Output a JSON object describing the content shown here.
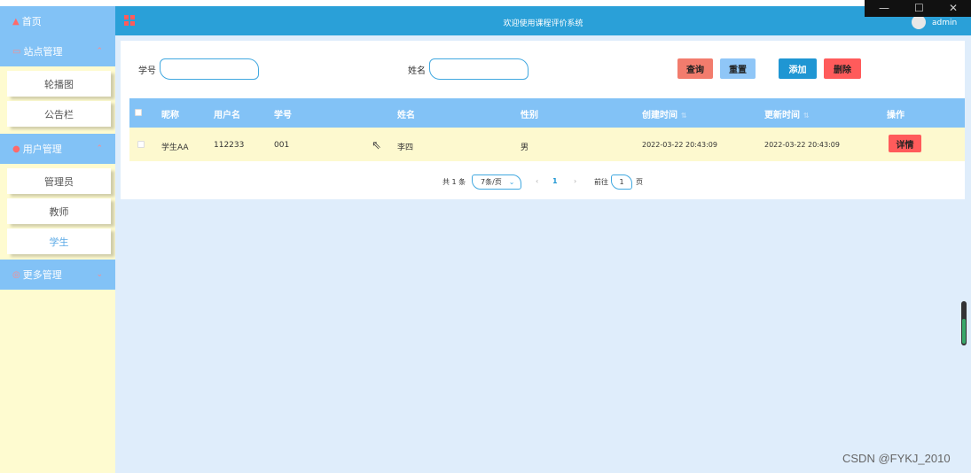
{
  "window": {
    "minimize_glyph": "—",
    "maximize_glyph": "☐",
    "close_glyph": "✕"
  },
  "sidebar": {
    "home": {
      "label": "首页",
      "icon": "home-icon"
    },
    "groups": [
      {
        "label": "站点管理",
        "icon": "site-icon",
        "items": [
          "轮播图",
          "公告栏"
        ]
      },
      {
        "label": "用户管理",
        "icon": "user-icon",
        "items": [
          "管理员",
          "教师",
          "学生"
        ]
      },
      {
        "label": "更多管理",
        "icon": "more-icon",
        "items": []
      }
    ],
    "active_item": "学生"
  },
  "header": {
    "title": "欢迎使用课程评价系统",
    "username": "admin"
  },
  "search": {
    "student_id_label": "学号",
    "student_id_value": "",
    "name_label": "姓名",
    "name_value": ""
  },
  "buttons": {
    "query": "查询",
    "reset": "重置",
    "add": "添加",
    "delete": "删除"
  },
  "table": {
    "columns": [
      "昵称",
      "用户名",
      "学号",
      "姓名",
      "性别",
      "创建时间",
      "更新时间",
      "操作"
    ],
    "rows": [
      {
        "nickname": "学生AA",
        "username": "112233",
        "student_id": "001",
        "name": "李四",
        "gender": "男",
        "created": "2022-03-22 20:43:09",
        "updated": "2022-03-22 20:43:09",
        "action": "详情"
      }
    ]
  },
  "pagination": {
    "total": "共 1 条",
    "page_size": "7条/页",
    "prev": "‹",
    "current_page": "1",
    "next": "›",
    "goto_label": "前往",
    "goto_value": "1",
    "page_suffix": "页"
  },
  "watermark": "CSDN @FYKJ_2010",
  "colors": {
    "sidebar_bg": "#fefbd0",
    "nav_blue": "#82c2f6",
    "header_blue": "#2aa0d8",
    "accent_red": "#ff5b5b"
  }
}
